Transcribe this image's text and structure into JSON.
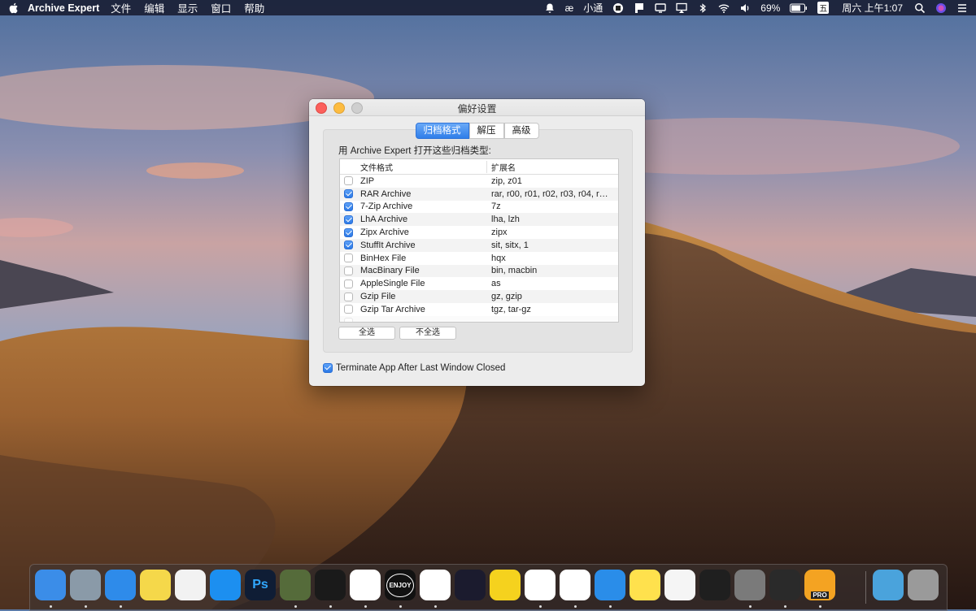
{
  "menubar": {
    "app_name": "Archive Expert",
    "menus": [
      "文件",
      "编辑",
      "显示",
      "窗口",
      "帮助"
    ],
    "input_method": "小通",
    "battery": "69%",
    "keyboard_badge": "五",
    "clock": "周六 上午1:07"
  },
  "window": {
    "title": "偏好设置",
    "tabs": [
      "归档格式",
      "解压",
      "高级"
    ],
    "active_tab": 0,
    "intro": "用 Archive Expert 打开这些归档类型:",
    "columns": {
      "format": "文件格式",
      "extension": "扩展名"
    },
    "rows": [
      {
        "name": "ZIP",
        "ext": "zip, z01",
        "checked": false
      },
      {
        "name": "RAR Archive",
        "ext": "rar, r00, r01, r02, r03, r04, r…",
        "checked": true
      },
      {
        "name": "7-Zip Archive",
        "ext": "7z",
        "checked": true
      },
      {
        "name": "LhA Archive",
        "ext": "lha, lzh",
        "checked": true
      },
      {
        "name": "Zipx Archive",
        "ext": "zipx",
        "checked": true
      },
      {
        "name": "StuffIt Archive",
        "ext": "sit, sitx, 1",
        "checked": true
      },
      {
        "name": "BinHex File",
        "ext": "hqx",
        "checked": false
      },
      {
        "name": "MacBinary File",
        "ext": "bin, macbin",
        "checked": false
      },
      {
        "name": "AppleSingle File",
        "ext": "as",
        "checked": false
      },
      {
        "name": "Gzip File",
        "ext": "gz, gzip",
        "checked": false
      },
      {
        "name": "Gzip Tar Archive",
        "ext": "tgz, tar-gz",
        "checked": false
      },
      {
        "name": "",
        "ext": "",
        "checked": false
      }
    ],
    "select_all": "全选",
    "select_none": "不全选",
    "terminate_label": "Terminate App After Last Window Closed",
    "terminate_checked": true
  },
  "dock": {
    "apps": [
      {
        "name": "finder",
        "color": "#3b8de8"
      },
      {
        "name": "launchpad",
        "color": "#8a9aa8"
      },
      {
        "name": "safari",
        "color": "#2e8bea"
      },
      {
        "name": "notes",
        "color": "#f5d84a"
      },
      {
        "name": "itunes",
        "color": "#f2f2f2"
      },
      {
        "name": "app-store",
        "color": "#1c8ff0"
      },
      {
        "name": "photoshop",
        "color": "#0f1d35",
        "label": "Ps"
      },
      {
        "name": "disk-utility",
        "color": "#556b3a"
      },
      {
        "name": "qq",
        "color": "#1a1a1a"
      },
      {
        "name": "wechat",
        "color": "#ffffff"
      },
      {
        "name": "enjoy",
        "color": "#111111",
        "label": "ENJOY"
      },
      {
        "name": "netease-music",
        "color": "#ffffff"
      },
      {
        "name": "infuse",
        "color": "#1b1b2e"
      },
      {
        "name": "qq-music",
        "color": "#f5d21e"
      },
      {
        "name": "direct-mail",
        "color": "#ffffff"
      },
      {
        "name": "chrome",
        "color": "#ffffff"
      },
      {
        "name": "icloud",
        "color": "#2a8de9"
      },
      {
        "name": "archiver",
        "color": "#ffe14d"
      },
      {
        "name": "textedit",
        "color": "#f5f5f5"
      },
      {
        "name": "terminal",
        "color": "#1f1f1f"
      },
      {
        "name": "scanner",
        "color": "#7a7a7a"
      },
      {
        "name": "activity",
        "color": "#2a2a2a"
      },
      {
        "name": "archive-expert-pro",
        "color": "#f4a322",
        "label": "PRO"
      },
      {
        "name": "downloads-folder",
        "color": "#4aa3dc"
      },
      {
        "name": "trash",
        "color": "#9a9a9a"
      }
    ]
  }
}
